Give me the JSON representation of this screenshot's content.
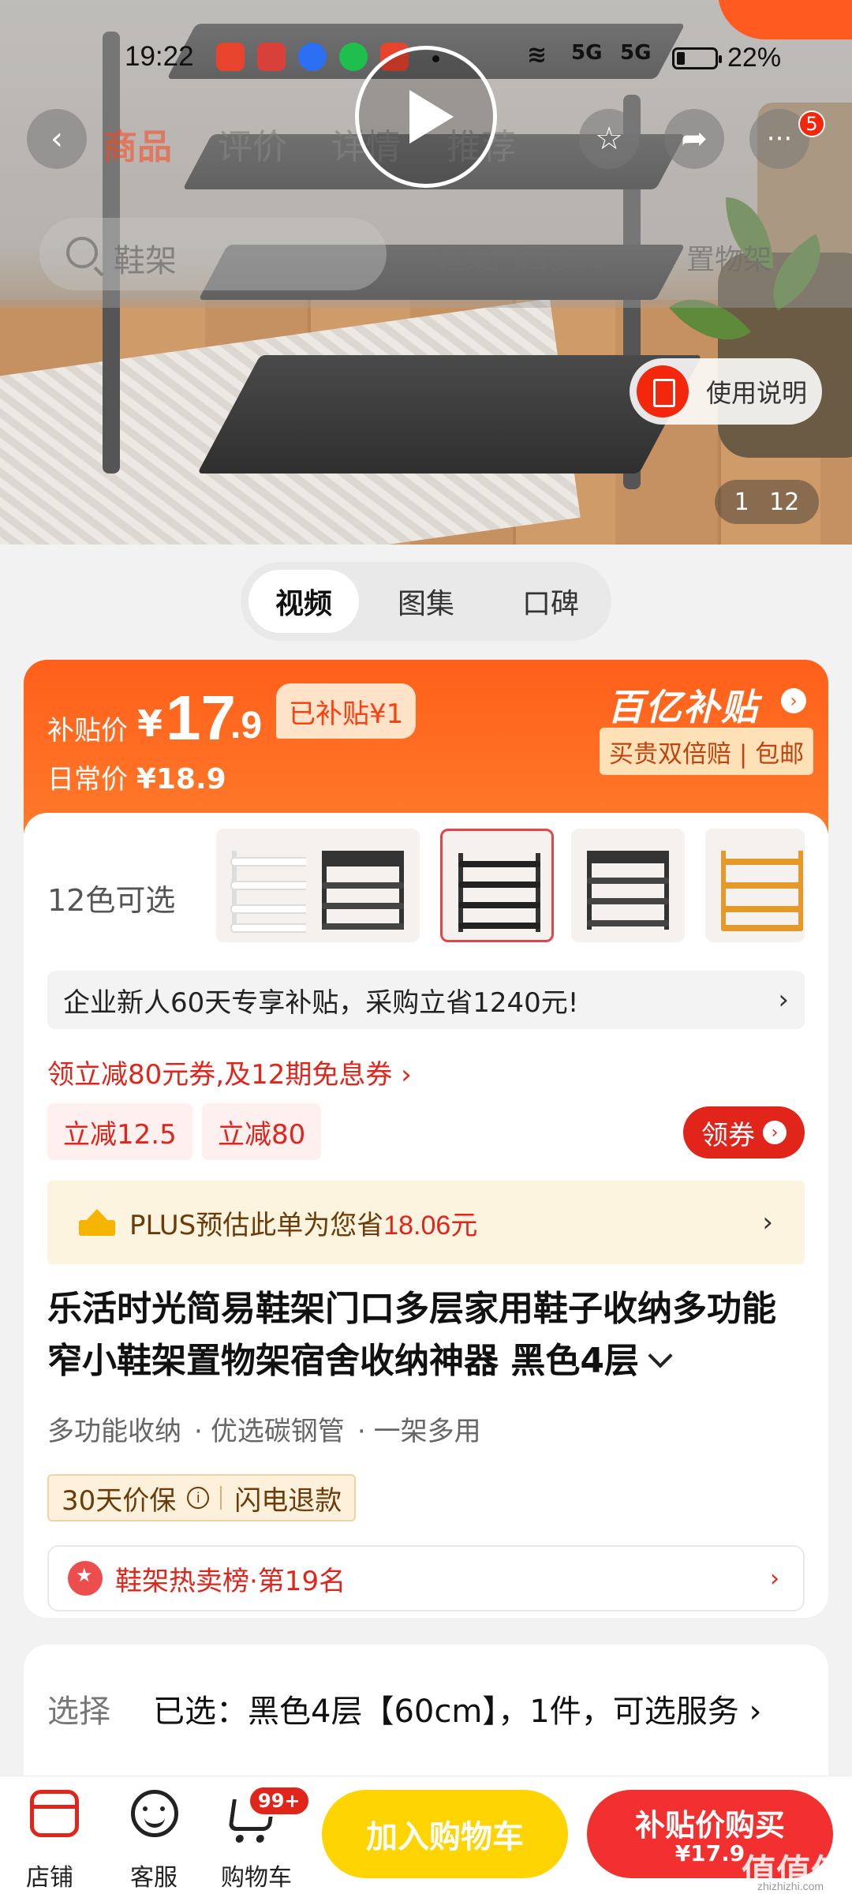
{
  "status_bar": {
    "time": "19:22",
    "battery": "22%",
    "sig1": "5G",
    "sig2": "5G"
  },
  "nav": {
    "tabs": [
      "商品",
      "评价",
      "详情",
      "推荐"
    ],
    "more_badge": "5"
  },
  "search": {
    "placeholder": "鞋架",
    "hints": [
      "鞋架门口多...",
      "置物架"
    ]
  },
  "hero": {
    "manual_label": "使用说明",
    "image_index": "1",
    "image_total": "12"
  },
  "media_tabs": [
    "视频",
    "图集",
    "口碑"
  ],
  "price": {
    "subsidy_label": "补贴价",
    "currency": "¥",
    "int": "17",
    "dec": ".9",
    "subsidized_tag": "已补贴¥1",
    "daily_label": "日常价",
    "daily_price": "¥18.9",
    "program_name": "百亿补贴",
    "program_arrow": "›",
    "guarantee_chip": "买贵双倍赔 | 包邮"
  },
  "variants": {
    "count_label": "12色可选"
  },
  "promos": {
    "enterprise": "企业新人60天专享补贴，采购立省1240元!",
    "coupon_link": "领立减80元券,及12期免息券 ›",
    "tags": [
      "立减12.5",
      "立减80"
    ],
    "grab_coupon": "领券",
    "plus_prefix": "PLUS预估此单为您省",
    "plus_amount": "18.06元"
  },
  "product": {
    "title": "乐活时光简易鞋架门口多层家用鞋子收纳多功能窄小鞋架置物架宿舍收纳神器 黑色4层",
    "features": [
      "多功能收纳",
      "优选碳钢管",
      "一架多用"
    ],
    "guarantee_1": "30天价保",
    "guarantee_2": "闪电退款",
    "rank": "鞋架热卖榜·第19名"
  },
  "selection": {
    "label": "选择",
    "value": "已选：黑色4层【60cm】，1件，可选服务 ›"
  },
  "bottom_bar": {
    "shop": "店铺",
    "service": "客服",
    "cart": "购物车",
    "cart_badge": "99+",
    "add_to_cart": "加入购物车",
    "buy_label": "补贴价购买",
    "buy_price": "¥17.9"
  },
  "watermark": {
    "text": "值值值",
    "url": "zhizhizhi.com"
  }
}
